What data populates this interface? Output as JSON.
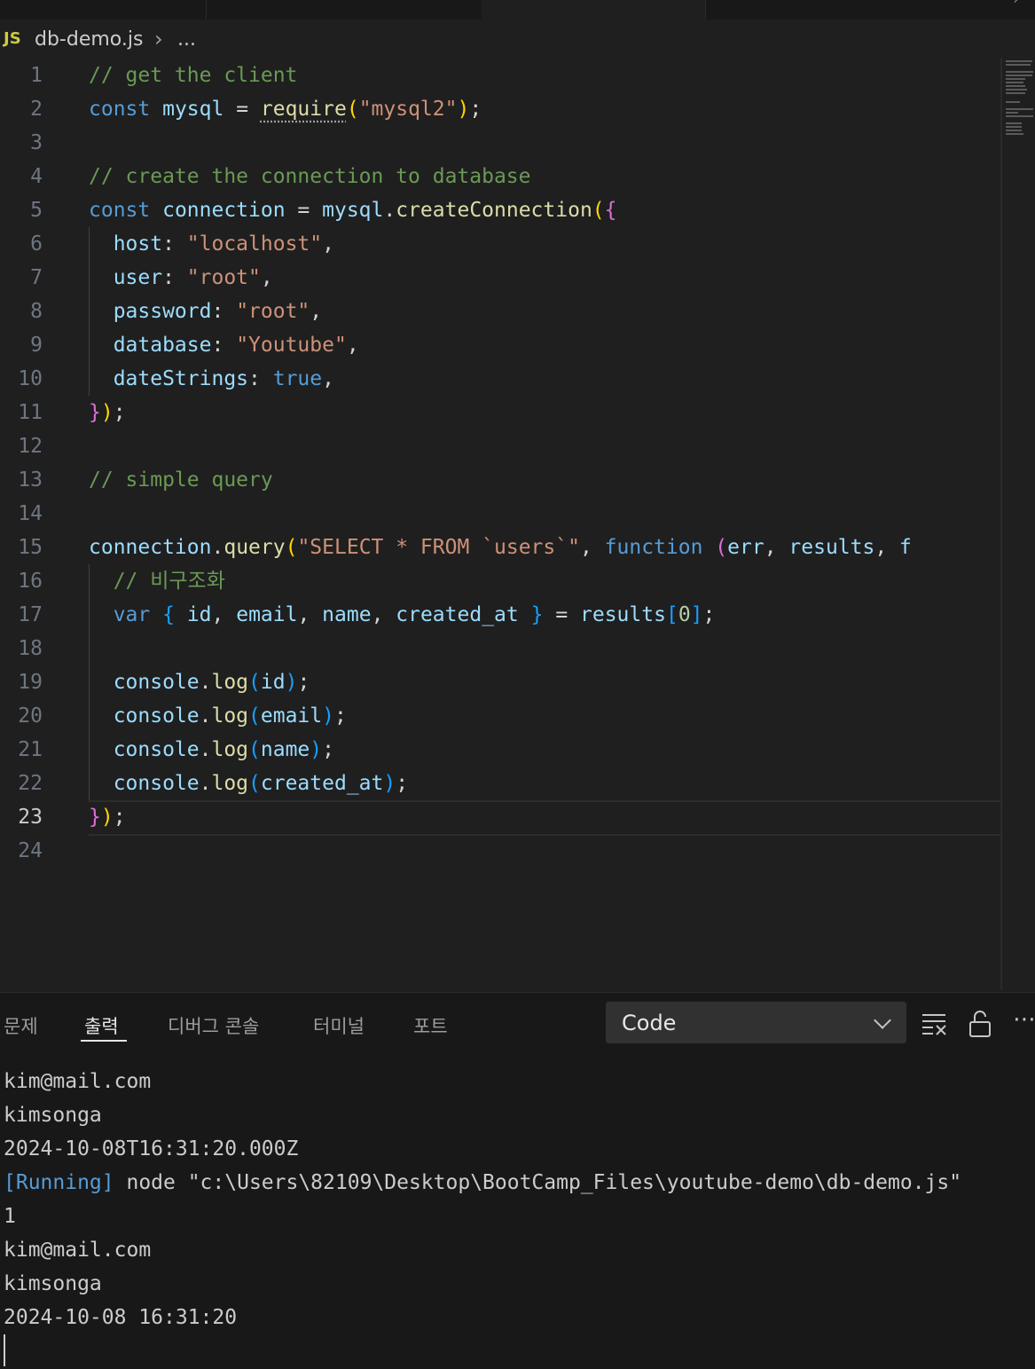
{
  "breadcrumb": {
    "lang_badge": "JS",
    "file": "db-demo.js",
    "more": "..."
  },
  "editor": {
    "current_line": 23,
    "lines": [
      {
        "n": "1",
        "tokens": [
          {
            "t": "// get the client",
            "c": "c"
          }
        ]
      },
      {
        "n": "2",
        "tokens": [
          {
            "t": "const ",
            "c": "k"
          },
          {
            "t": "mysql",
            "c": "v"
          },
          {
            "t": " = ",
            "c": "p"
          },
          {
            "t": "require",
            "c": "f squiggle"
          },
          {
            "t": "(",
            "c": "b1"
          },
          {
            "t": "\"mysql2\"",
            "c": "s"
          },
          {
            "t": ")",
            "c": "b1"
          },
          {
            "t": ";",
            "c": "p"
          }
        ]
      },
      {
        "n": "3",
        "tokens": []
      },
      {
        "n": "4",
        "tokens": [
          {
            "t": "// create the connection to database",
            "c": "c"
          }
        ]
      },
      {
        "n": "5",
        "tokens": [
          {
            "t": "const ",
            "c": "k"
          },
          {
            "t": "connection",
            "c": "v"
          },
          {
            "t": " = ",
            "c": "p"
          },
          {
            "t": "mysql",
            "c": "v"
          },
          {
            "t": ".",
            "c": "p"
          },
          {
            "t": "createConnection",
            "c": "f"
          },
          {
            "t": "(",
            "c": "b1"
          },
          {
            "t": "{",
            "c": "b2"
          }
        ]
      },
      {
        "n": "6",
        "tokens": [
          {
            "t": "  host",
            "c": "v"
          },
          {
            "t": ": ",
            "c": "p"
          },
          {
            "t": "\"localhost\"",
            "c": "s"
          },
          {
            "t": ",",
            "c": "p"
          }
        ]
      },
      {
        "n": "7",
        "tokens": [
          {
            "t": "  user",
            "c": "v"
          },
          {
            "t": ": ",
            "c": "p"
          },
          {
            "t": "\"root\"",
            "c": "s"
          },
          {
            "t": ",",
            "c": "p"
          }
        ]
      },
      {
        "n": "8",
        "tokens": [
          {
            "t": "  password",
            "c": "v"
          },
          {
            "t": ": ",
            "c": "p"
          },
          {
            "t": "\"root\"",
            "c": "s"
          },
          {
            "t": ",",
            "c": "p"
          }
        ]
      },
      {
        "n": "9",
        "tokens": [
          {
            "t": "  database",
            "c": "v"
          },
          {
            "t": ": ",
            "c": "p"
          },
          {
            "t": "\"Youtube\"",
            "c": "s"
          },
          {
            "t": ",",
            "c": "p"
          }
        ]
      },
      {
        "n": "10",
        "tokens": [
          {
            "t": "  dateStrings",
            "c": "v"
          },
          {
            "t": ": ",
            "c": "p"
          },
          {
            "t": "true",
            "c": "k"
          },
          {
            "t": ",",
            "c": "p"
          }
        ]
      },
      {
        "n": "11",
        "tokens": [
          {
            "t": "}",
            "c": "b2"
          },
          {
            "t": ")",
            "c": "b1"
          },
          {
            "t": ";",
            "c": "p"
          }
        ]
      },
      {
        "n": "12",
        "tokens": []
      },
      {
        "n": "13",
        "tokens": [
          {
            "t": "// simple query",
            "c": "c"
          }
        ]
      },
      {
        "n": "14",
        "tokens": []
      },
      {
        "n": "15",
        "tokens": [
          {
            "t": "connection",
            "c": "v"
          },
          {
            "t": ".",
            "c": "p"
          },
          {
            "t": "query",
            "c": "f"
          },
          {
            "t": "(",
            "c": "b1"
          },
          {
            "t": "\"SELECT * FROM `users`\"",
            "c": "s"
          },
          {
            "t": ", ",
            "c": "p"
          },
          {
            "t": "function",
            "c": "k"
          },
          {
            "t": " ",
            "c": "p"
          },
          {
            "t": "(",
            "c": "b2"
          },
          {
            "t": "err",
            "c": "v"
          },
          {
            "t": ", ",
            "c": "p"
          },
          {
            "t": "results",
            "c": "v"
          },
          {
            "t": ", ",
            "c": "p"
          },
          {
            "t": "f",
            "c": "v"
          }
        ]
      },
      {
        "n": "16",
        "tokens": [
          {
            "t": "  // 비구조화",
            "c": "c"
          }
        ]
      },
      {
        "n": "17",
        "tokens": [
          {
            "t": "  var ",
            "c": "k"
          },
          {
            "t": "{",
            "c": "b3"
          },
          {
            "t": " ",
            "c": "p"
          },
          {
            "t": "id",
            "c": "v"
          },
          {
            "t": ", ",
            "c": "p"
          },
          {
            "t": "email",
            "c": "v"
          },
          {
            "t": ", ",
            "c": "p"
          },
          {
            "t": "name",
            "c": "v"
          },
          {
            "t": ", ",
            "c": "p"
          },
          {
            "t": "created_at",
            "c": "v"
          },
          {
            "t": " ",
            "c": "p"
          },
          {
            "t": "}",
            "c": "b3"
          },
          {
            "t": " = ",
            "c": "p"
          },
          {
            "t": "results",
            "c": "v"
          },
          {
            "t": "[",
            "c": "b3"
          },
          {
            "t": "0",
            "c": "n"
          },
          {
            "t": "]",
            "c": "b3"
          },
          {
            "t": ";",
            "c": "p"
          }
        ]
      },
      {
        "n": "18",
        "tokens": []
      },
      {
        "n": "19",
        "tokens": [
          {
            "t": "  console",
            "c": "v"
          },
          {
            "t": ".",
            "c": "p"
          },
          {
            "t": "log",
            "c": "f"
          },
          {
            "t": "(",
            "c": "b3"
          },
          {
            "t": "id",
            "c": "v"
          },
          {
            "t": ")",
            "c": "b3"
          },
          {
            "t": ";",
            "c": "p"
          }
        ]
      },
      {
        "n": "20",
        "tokens": [
          {
            "t": "  console",
            "c": "v"
          },
          {
            "t": ".",
            "c": "p"
          },
          {
            "t": "log",
            "c": "f"
          },
          {
            "t": "(",
            "c": "b3"
          },
          {
            "t": "email",
            "c": "v"
          },
          {
            "t": ")",
            "c": "b3"
          },
          {
            "t": ";",
            "c": "p"
          }
        ]
      },
      {
        "n": "21",
        "tokens": [
          {
            "t": "  console",
            "c": "v"
          },
          {
            "t": ".",
            "c": "p"
          },
          {
            "t": "log",
            "c": "f"
          },
          {
            "t": "(",
            "c": "b3"
          },
          {
            "t": "name",
            "c": "v"
          },
          {
            "t": ")",
            "c": "b3"
          },
          {
            "t": ";",
            "c": "p"
          }
        ]
      },
      {
        "n": "22",
        "tokens": [
          {
            "t": "  console",
            "c": "v"
          },
          {
            "t": ".",
            "c": "p"
          },
          {
            "t": "log",
            "c": "f"
          },
          {
            "t": "(",
            "c": "b3"
          },
          {
            "t": "created_at",
            "c": "v"
          },
          {
            "t": ")",
            "c": "b3"
          },
          {
            "t": ";",
            "c": "p"
          }
        ]
      },
      {
        "n": "23",
        "tokens": [
          {
            "t": "}",
            "c": "b2"
          },
          {
            "t": ")",
            "c": "b1"
          },
          {
            "t": ";",
            "c": "p"
          }
        ]
      },
      {
        "n": "24",
        "tokens": []
      }
    ]
  },
  "panel": {
    "tabs": [
      "문제",
      "출력",
      "디버그 콘솔",
      "터미널",
      "포트"
    ],
    "active_tab": "출력",
    "output_channel": "Code"
  },
  "output": {
    "lines": [
      {
        "text": "kim@mail.com"
      },
      {
        "text": "kimsonga"
      },
      {
        "text": "2024-10-08T16:31:20.000Z"
      },
      {
        "tag": "[Running]",
        "text": " node \"c:\\Users\\82109\\Desktop\\BootCamp_Files\\youtube-demo\\db-demo.js\""
      },
      {
        "text": "1"
      },
      {
        "text": "kim@mail.com"
      },
      {
        "text": "kimsonga"
      },
      {
        "text": "2024-10-08 16:31:20"
      }
    ]
  }
}
